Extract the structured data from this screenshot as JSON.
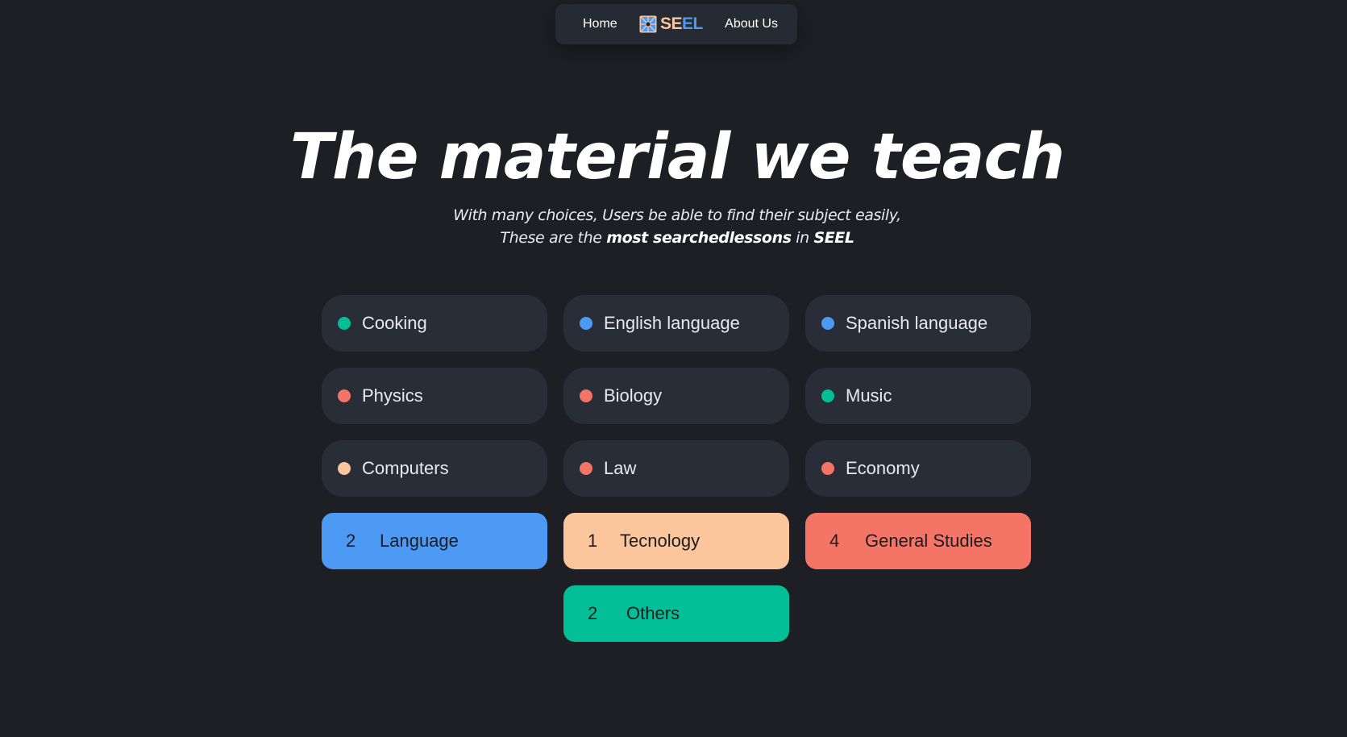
{
  "nav": {
    "home_label": "Home",
    "brand_se": "SE",
    "brand_el": "EL",
    "about_label": "About Us"
  },
  "hero": {
    "title": "The material we teach",
    "subtitle_line1": "With many choices, Users be able to find their subject easily,",
    "subtitle_line2_prefix": "These are the ",
    "subtitle_line2_bold": "most searchedlessons",
    "subtitle_line2_mid": " in ",
    "subtitle_line2_brand": "SEEL"
  },
  "colors": {
    "background": "#1e1f24",
    "chip_bg": "#292d37",
    "language": "#4d9af5",
    "technology": "#fbc69b",
    "general_studies": "#f47465",
    "others": "#03bf97"
  },
  "subjects": [
    {
      "label": "Cooking",
      "dot_color": "#03bf97"
    },
    {
      "label": "English language",
      "dot_color": "#4d9af5"
    },
    {
      "label": "Spanish language",
      "dot_color": "#4d9af5"
    },
    {
      "label": "Physics",
      "dot_color": "#f47465"
    },
    {
      "label": "Biology",
      "dot_color": "#f47465"
    },
    {
      "label": "Music",
      "dot_color": "#03bf97"
    },
    {
      "label": "Computers",
      "dot_color": "#fbc69b"
    },
    {
      "label": "Law",
      "dot_color": "#f47465"
    },
    {
      "label": "Economy",
      "dot_color": "#f47465"
    }
  ],
  "categories": [
    {
      "count": "2",
      "label": "Language",
      "color": "#4d9af5"
    },
    {
      "count": "1",
      "label": "Tecnology",
      "color": "#fbc69b"
    },
    {
      "count": "4",
      "label": "General Studies",
      "color": "#f47465"
    },
    {
      "count": "2",
      "label": "Others",
      "color": "#03bf97"
    }
  ]
}
